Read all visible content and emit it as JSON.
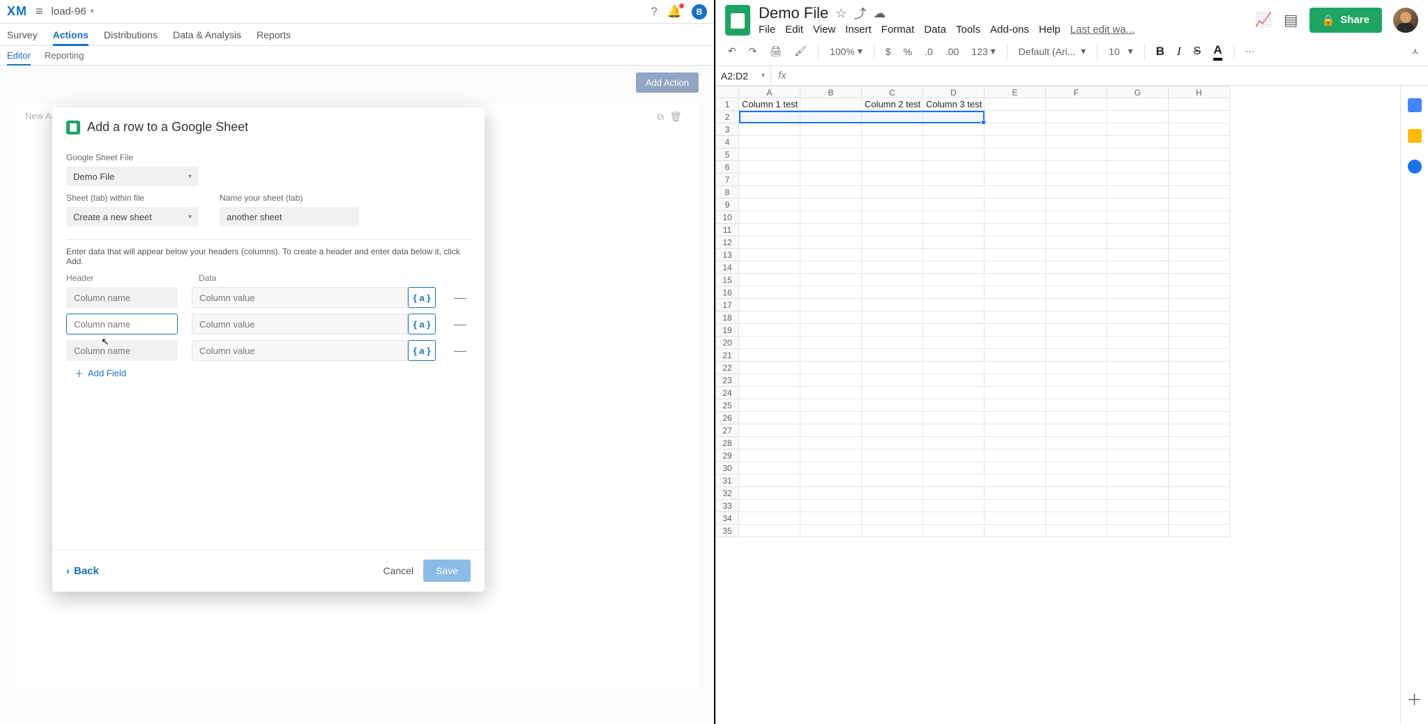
{
  "qualtrics": {
    "logo_text": "XM",
    "project_name": "load-96",
    "avatar_letter": "B",
    "tabs": [
      "Survey",
      "Actions",
      "Distributions",
      "Data & Analysis",
      "Reports"
    ],
    "subtabs": [
      "Editor",
      "Reporting"
    ],
    "bg_box_label": "New Actio",
    "add_action_btn": "Add Action",
    "modal": {
      "title": "Add a row to a Google Sheet",
      "file_label": "Google Sheet File",
      "file_value": "Demo File",
      "sheet_tab_label": "Sheet (tab) within file",
      "sheet_tab_value": "Create a new sheet",
      "name_sheet_label": "Name your sheet (tab)",
      "name_sheet_value": "another sheet",
      "helper": "Enter data that will appear below your headers (columns). To create a header and enter data below it, click Add.",
      "header_col": "Header",
      "data_col": "Data",
      "column_name_ph": "Column name",
      "column_value_ph": "Column value",
      "var_token": "{ a }",
      "add_field": "Add Field",
      "back": "Back",
      "cancel": "Cancel",
      "save": "Save"
    }
  },
  "sheets": {
    "doc_title": "Demo File",
    "menus": [
      "File",
      "Edit",
      "View",
      "Insert",
      "Format",
      "Data",
      "Tools",
      "Add-ons",
      "Help"
    ],
    "last_edit": "Last edit wa...",
    "share": "Share",
    "zoom": "100%",
    "number_fmt": "123",
    "font": "Default (Ari...",
    "font_size": "10",
    "namebox": "A2:D2",
    "bold": "B",
    "italic": "I",
    "strike": "S",
    "textcolor": "A",
    "col_letters": [
      "A",
      "B",
      "C",
      "D",
      "E",
      "F",
      "G",
      "H"
    ],
    "row_count": 35,
    "cells": {
      "A1": "Column 1 test",
      "C1": "Column 2 test",
      "D1": "Column 3 test"
    }
  }
}
